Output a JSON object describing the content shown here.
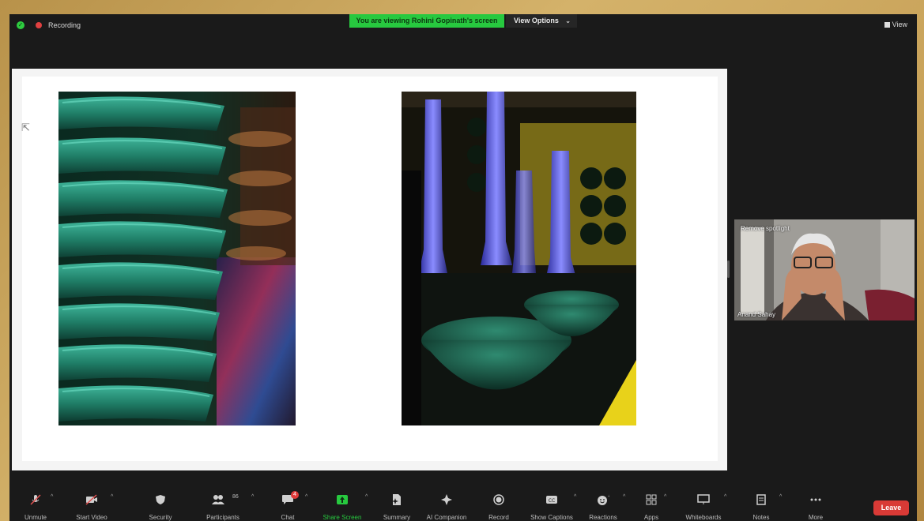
{
  "topbar": {
    "recording_label": "Recording",
    "viewing_banner": "You are viewing Rohini Gopinath's screen",
    "view_options_label": "View Options",
    "view_label": "View"
  },
  "participant": {
    "name": "Anand Sahay",
    "spotlight_label": "Remove spotlight"
  },
  "toolbar": {
    "unmute": "Unmute",
    "start_video": "Start Video",
    "security": "Security",
    "participants": "Participants",
    "participants_count": "86",
    "chat": "Chat",
    "chat_badge": "4",
    "share_screen": "Share Screen",
    "summary": "Summary",
    "ai_companion": "AI Companion",
    "record": "Record",
    "show_captions": "Show Captions",
    "reactions": "Reactions",
    "apps": "Apps",
    "whiteboards": "Whiteboards",
    "notes": "Notes",
    "more": "More",
    "leave": "Leave"
  },
  "colors": {
    "share_banner": "#27c93f",
    "leave_button": "#d93a36",
    "share_screen_label": "#27c93f"
  }
}
